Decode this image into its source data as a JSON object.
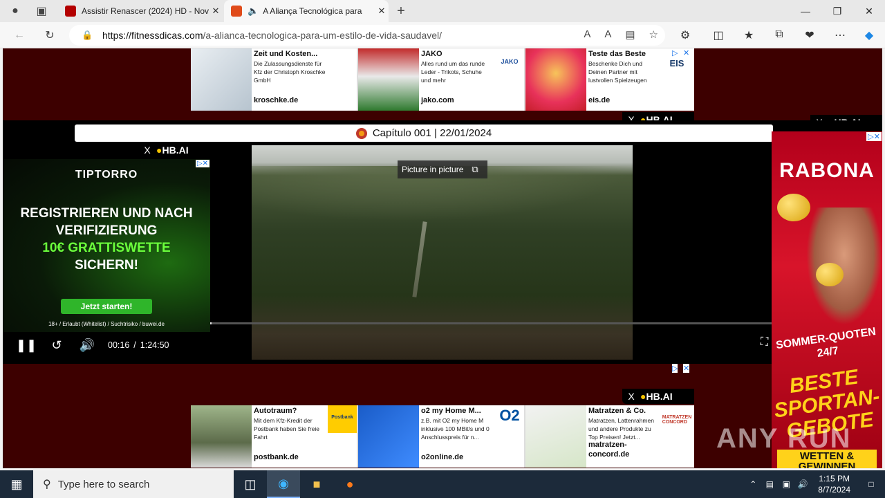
{
  "browser": {
    "tabs": [
      {
        "title": "Assistir Renascer (2024) HD - Nov",
        "favicon_color": "#b30000"
      },
      {
        "title": "A Aliança Tecnológica para",
        "favicon_color": "#e04b1a"
      }
    ],
    "url_host": "https://fitnessdicas.com",
    "url_path": "/a-alianca-tecnologica-para-um-estilo-de-vida-saudavel/"
  },
  "ads_top": [
    {
      "title": "Zeit und Kosten...",
      "desc": "Die Zulassungsdienste für Kfz der Christoph Kroschke GmbH",
      "domain": "kroschke.de",
      "logo": ""
    },
    {
      "title": "JAKO",
      "desc": "Alles rund um das runde Leder - Trikots, Schuhe und mehr",
      "domain": "jako.com",
      "logo": "JAKO"
    },
    {
      "title": "Teste das Beste",
      "desc": "Beschenke Dich und Deinen Partner mit lustvollen Spielzeugen",
      "domain": "eis.de",
      "logo": "EIS"
    }
  ],
  "ads_bottom": [
    {
      "title": "Autotraum?",
      "desc": "Mit dem Kfz-Kredit der Postbank haben Sie freie Fahrt",
      "domain": "postbank.de",
      "logo": "Postbank"
    },
    {
      "title": "o2 my Home M...",
      "desc": "z.B. mit O2 my Home M inklusive 100 MBit/s und 0 Anschlusspreis für n...",
      "domain": "o2online.de",
      "logo": "O2"
    },
    {
      "title": "Matratzen & Co.",
      "desc": "Matratzen, Lattenrahmen und andere Produkte zu Top Preisen! Jetzt...",
      "domain": "matratzen-concord.de",
      "logo": "MATRATZEN CONCORD"
    }
  ],
  "hb_label": "HB.AI",
  "hb_close": "X",
  "player": {
    "chapter": "Capítulo 001 | 22/01/2024",
    "pip_label": "Picture in picture",
    "current_time": "00:16",
    "duration": "1:24:50",
    "progress_fraction": 0.003
  },
  "left_ad": {
    "brand": "TIPTORRO",
    "line1": "REGISTRIEREN UND NACH VERIFIZIERUNG",
    "line2": "10€ GRATTISWETTE",
    "line3": "SICHERN!",
    "cta": "Jetzt starten!",
    "fine": "18+ / Erlaubt (Whitelist) / Suchtrisiko / buwei.de"
  },
  "right_ad": {
    "brand": "RABONA",
    "line1": "SOMMER-QUOTEN 24/7",
    "line2": "BESTE SPORTAN-GEBOTE",
    "cta": "WETTEN & GEWINNEN"
  },
  "watermark": "ANY RUN",
  "taskbar": {
    "search_placeholder": "Type here to search",
    "time": "1:15 PM",
    "date": "8/7/2024"
  }
}
